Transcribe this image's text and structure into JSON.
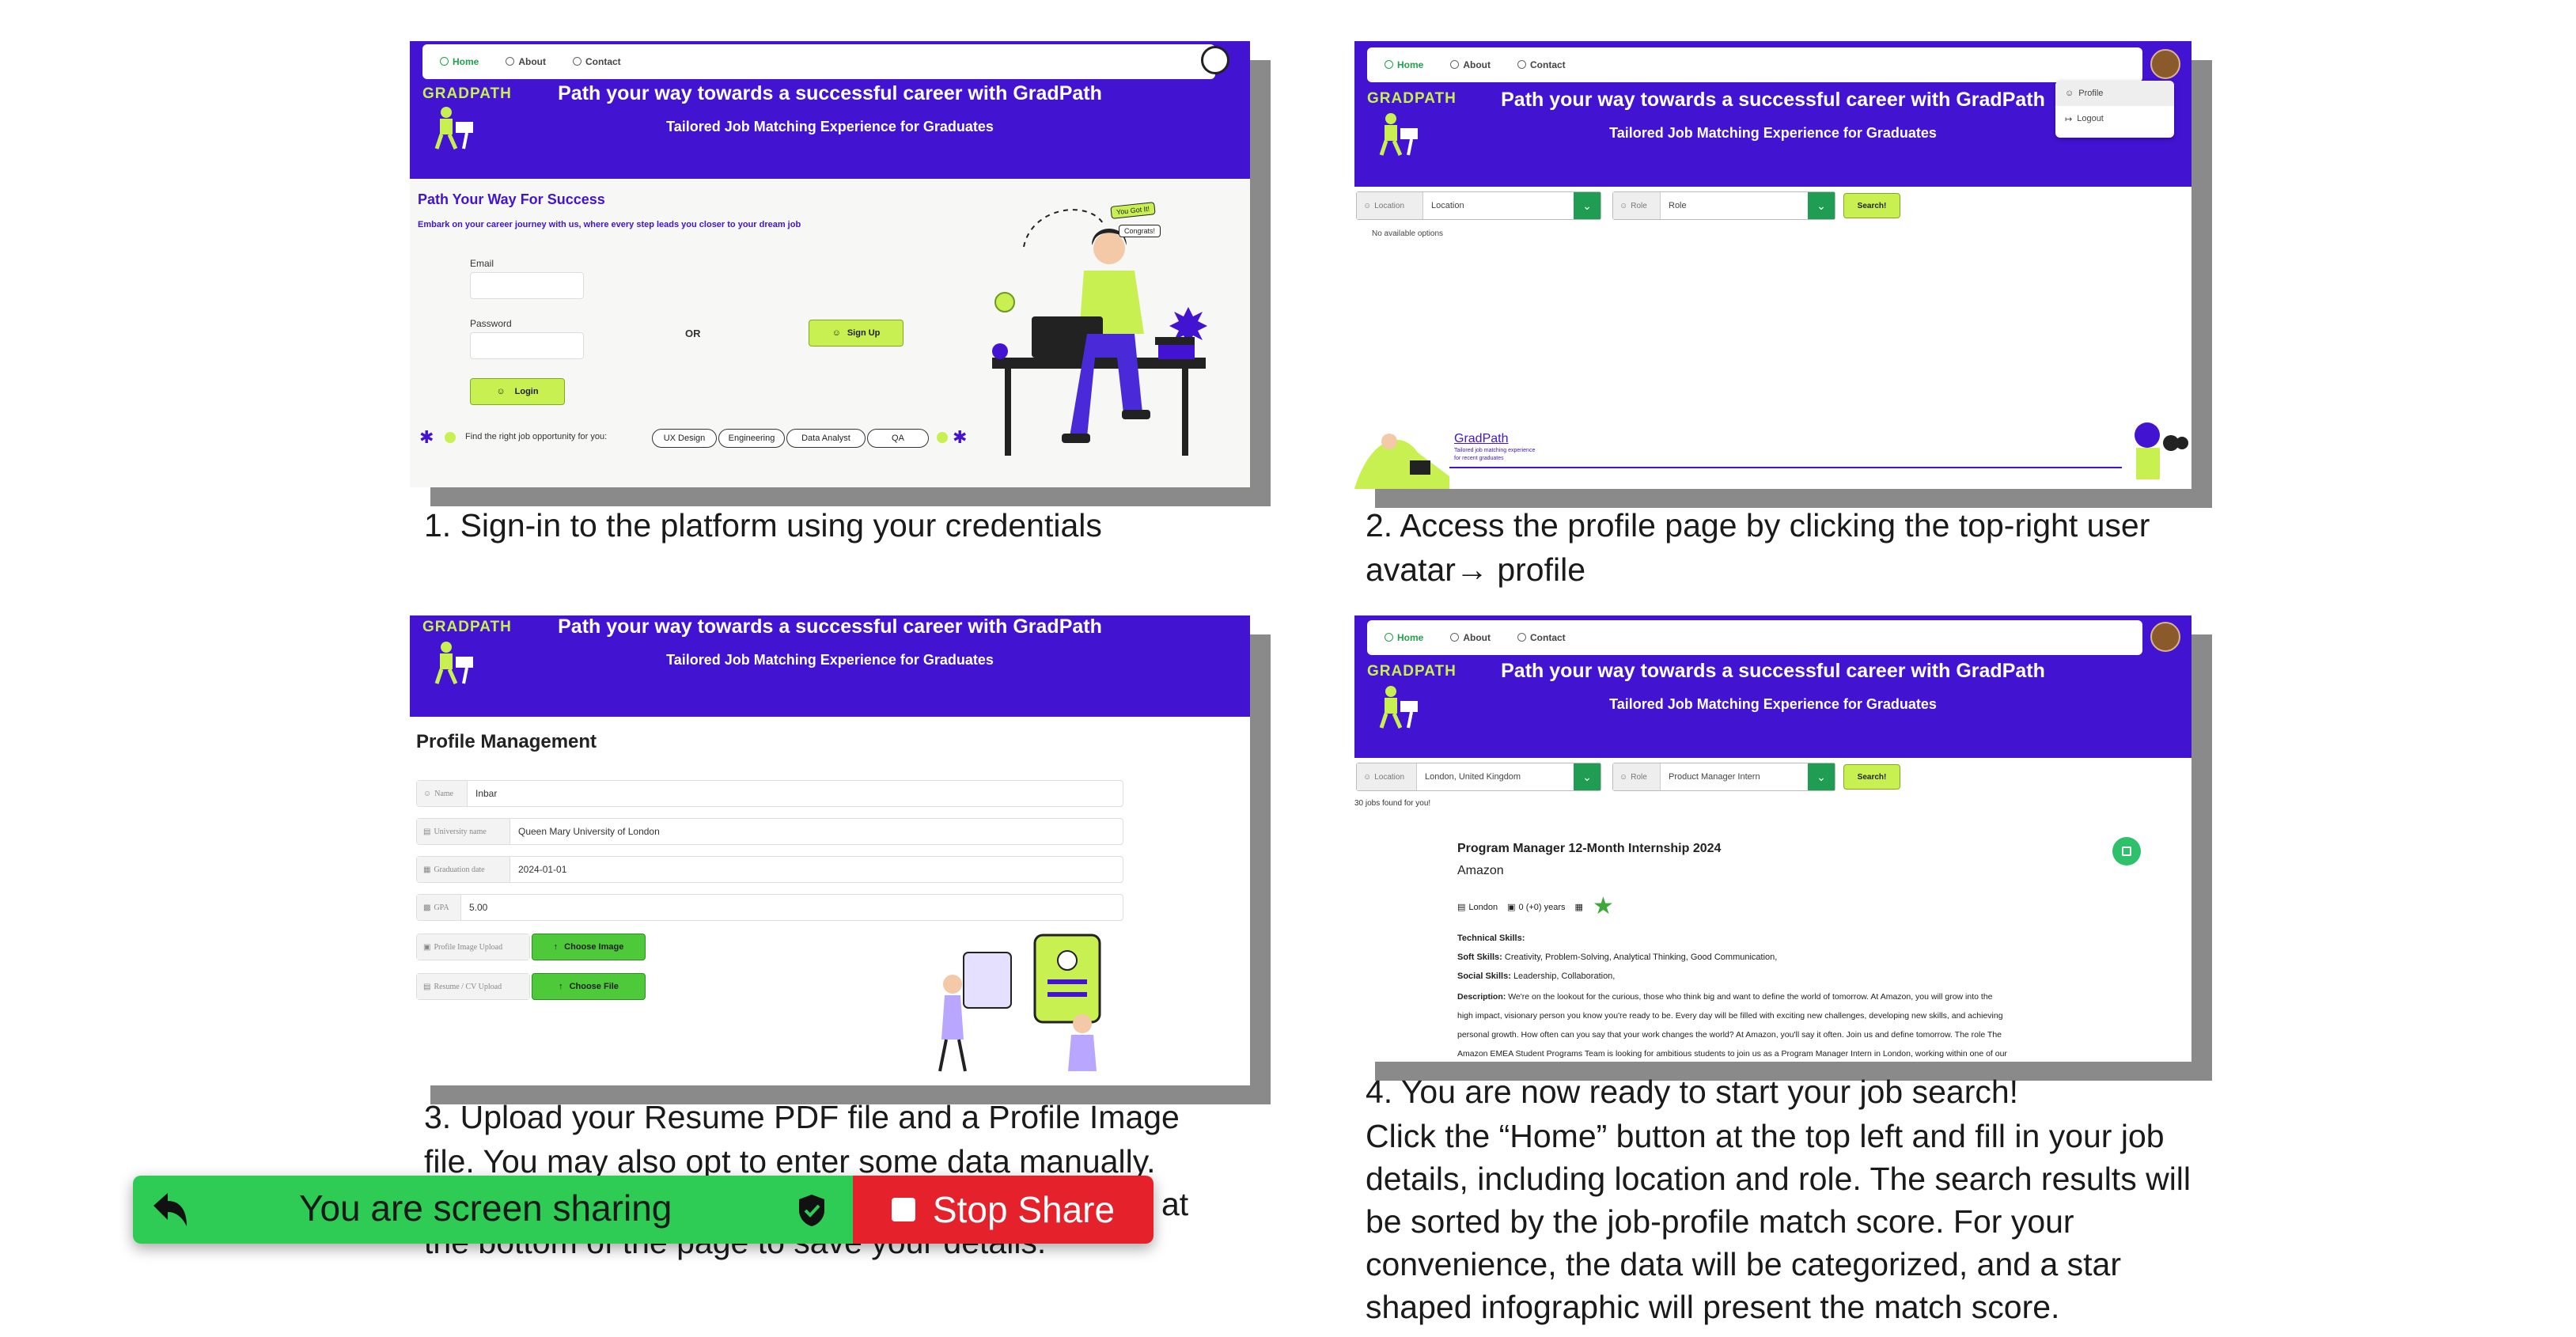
{
  "common": {
    "nav": {
      "home": "Home",
      "about": "About",
      "contact": "Contact"
    },
    "logo": "GRADPATH",
    "banner_title": "Path your way towards a successful career with GradPath",
    "banner_subtitle": "Tailored Job Matching Experience for Graduates"
  },
  "step1": {
    "heading": "Path Your Way For Success",
    "subheading": "Embark on your career journey with us, where every step leads you closer to your dream job",
    "email_label": "Email",
    "password_label": "Password",
    "or": "OR",
    "signup": "Sign Up",
    "login": "Login",
    "find_text": "Find the right job opportunity for you:",
    "tags": [
      "UX Design",
      "Engineering",
      "Data Analyst",
      "QA"
    ],
    "bubble1": "You Got It!",
    "bubble2": "Congrats!",
    "caption": "1. Sign-in to the platform using your credentials"
  },
  "step2": {
    "menu": [
      "Profile",
      "Logout"
    ],
    "location_prefix": "Location",
    "location_value": "Location",
    "role_prefix": "Role",
    "role_value": "Role",
    "search": "Search!",
    "no_options": "No available options",
    "footer_brand": "GradPath",
    "footer_tag1": "Tailored job matching experience",
    "footer_tag2": "for recent graduates",
    "caption": "2. Access the profile page by clicking the top-right user avatar→ profile"
  },
  "step3": {
    "title": "Profile Management",
    "fields": [
      {
        "key": "Name",
        "value": "Inbar"
      },
      {
        "key": "University name",
        "value": "Queen Mary University of London"
      },
      {
        "key": "Graduation date",
        "value": "2024-01-01"
      },
      {
        "key": "GPA",
        "value": "5.00"
      }
    ],
    "image_key": "Profile Image Upload",
    "image_btn": "Choose Image",
    "cv_key": "Resume / CV Upload",
    "cv_btn": "Choose File",
    "caption_l1": "3. Upload your Resume PDF file and a Profile Image",
    "caption_l2": "file. You may also opt to enter some data manually.",
    "caption_l3": "at",
    "caption_l4": "the bottom of the page to save your details."
  },
  "step4": {
    "location_prefix": "Location",
    "location_value": "London, United Kingdom",
    "role_prefix": "Role",
    "role_value": "Product Manager Intern",
    "search": "Search!",
    "count": "30 jobs found for you!",
    "job_title": "Program Manager 12-Month Internship 2024",
    "company": "Amazon",
    "meta_location": "London",
    "meta_years": "0 (+0) years",
    "tech_skills": "Technical Skills:",
    "soft_skills_label": "Soft Skills:",
    "soft_skills": "Creativity,   Problem-Solving,   Analytical Thinking,   Good Communication,",
    "social_skills_label": "Social Skills:",
    "social_skills": "Leadership,   Collaboration,",
    "desc_label": "Description:",
    "desc1": "We're on the lookout for the curious, those who think big and want to define the world of tomorrow. At Amazon, you will grow into the",
    "desc2": "high impact, visionary person you know you're ready to be. Every day will be filled with exciting new challenges, developing new skills, and achieving",
    "desc3": "personal growth. How often can you say that your work changes the world? At Amazon, you'll say it often. Join us and define tomorrow. The role The",
    "desc4": "Amazon EMEA Student Programs Team is looking for ambitious students to join us as a Program Manager Intern in London, working within one of our",
    "caption_l1": "4. You are now ready to start your job search!",
    "caption_l2": "Click the “Home” button at the top left and fill in your job",
    "caption_l3": "details, including location and role. The search results will",
    "caption_l4": "be sorted by the job-profile match score. For your",
    "caption_l5": "convenience, the data will be categorized, and a star",
    "caption_l6": "shaped infographic will present the match score."
  },
  "share": {
    "label": "You are screen sharing",
    "stop": "Stop Share"
  },
  "colors": {
    "banner": "#4313d2",
    "lime": "#c8f051",
    "share_green": "#2ecc55",
    "share_red": "#e5212b"
  }
}
